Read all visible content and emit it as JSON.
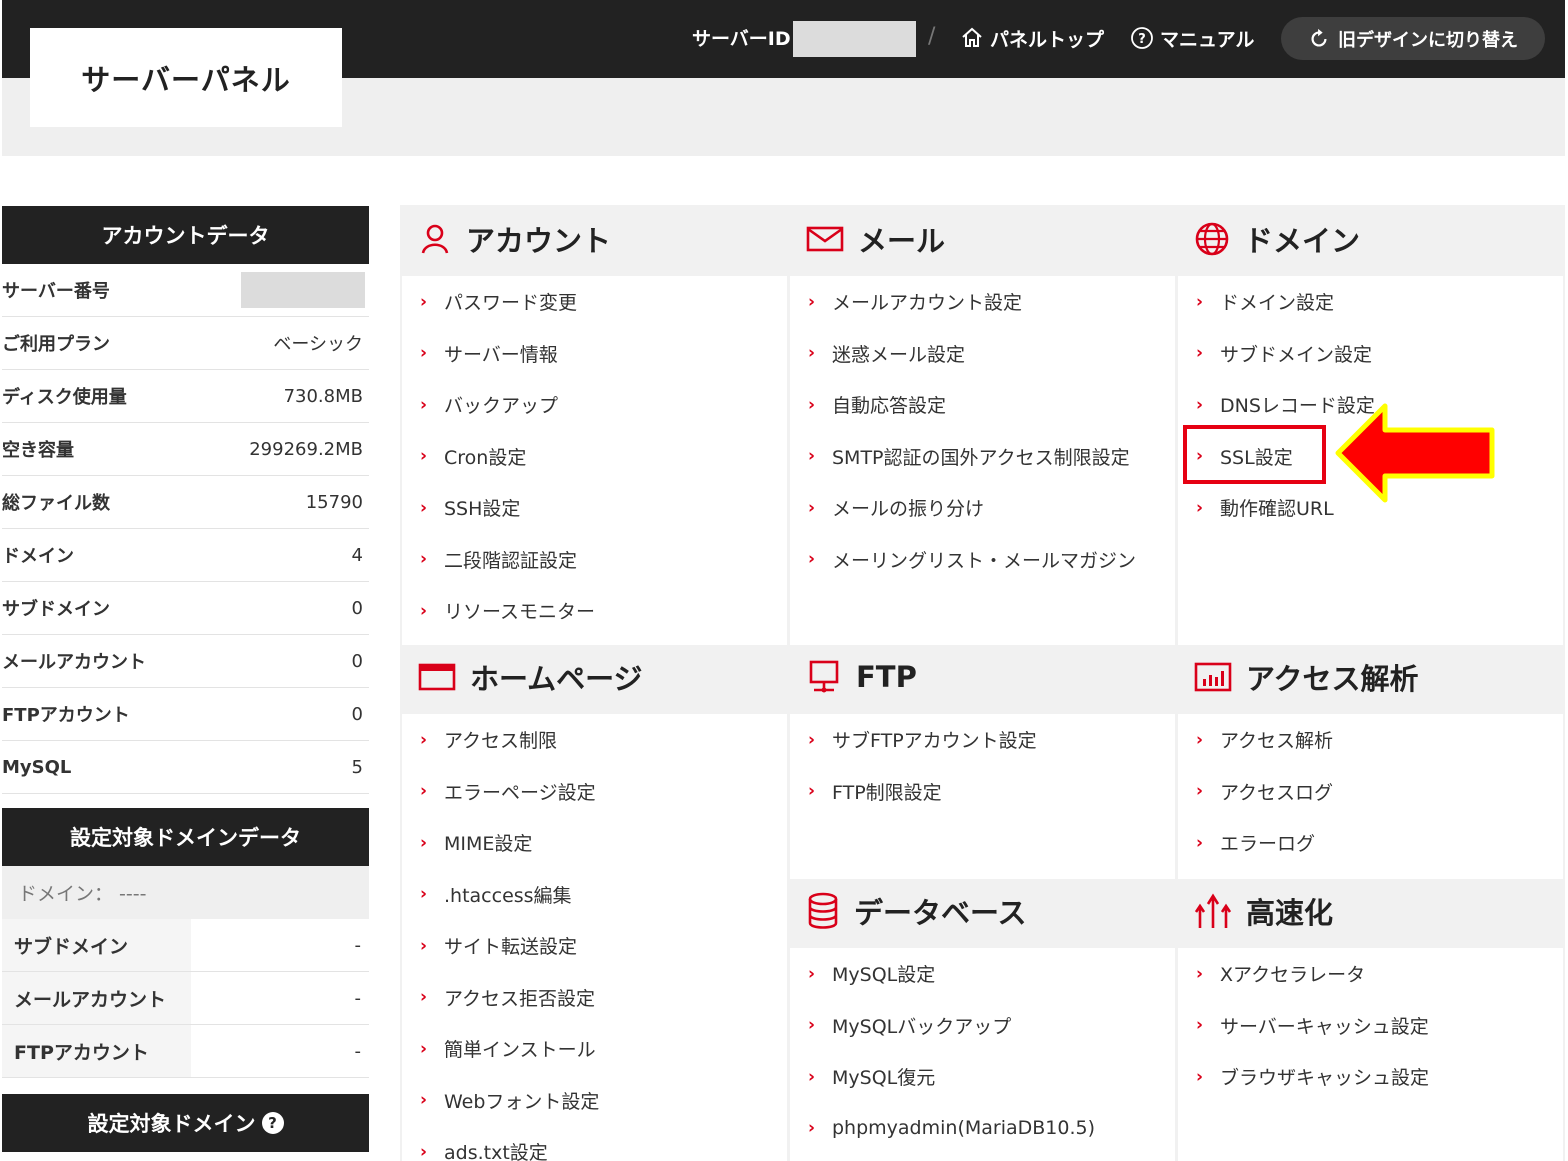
{
  "header": {
    "logo": "サーバーパネル",
    "server_id_label": "サーバーID",
    "separator": "/",
    "panel_top": "パネルトップ",
    "manual": "マニュアル",
    "switch_design": "旧デザインに切り替え"
  },
  "account_data": {
    "title": "アカウントデータ",
    "rows": [
      {
        "key": "サーバー番号",
        "value": ""
      },
      {
        "key": "ご利用プラン",
        "value": "ベーシック"
      },
      {
        "key": "ディスク使用量",
        "value": "730.8MB"
      },
      {
        "key": "空き容量",
        "value": "299269.2MB"
      },
      {
        "key": "総ファイル数",
        "value": "15790"
      },
      {
        "key": "ドメイン",
        "value": "4"
      },
      {
        "key": "サブドメイン",
        "value": "0"
      },
      {
        "key": "メールアカウント",
        "value": "0"
      },
      {
        "key": "FTPアカウント",
        "value": "0"
      },
      {
        "key": "MySQL",
        "value": "5"
      }
    ]
  },
  "target_domain_data": {
    "title": "設定対象ドメインデータ",
    "domain_line": "ドメイン： ----",
    "rows": [
      {
        "key": "サブドメイン",
        "value": "-"
      },
      {
        "key": "メールアカウント",
        "value": "-"
      },
      {
        "key": "FTPアカウント",
        "value": "-"
      }
    ]
  },
  "target_domain": {
    "title": "設定対象ドメイン",
    "help": "?"
  },
  "sections": {
    "account": {
      "title": "アカウント",
      "icon": "user-icon",
      "items": [
        "パスワード変更",
        "サーバー情報",
        "バックアップ",
        "Cron設定",
        "SSH設定",
        "二段階認証設定",
        "リソースモニター"
      ]
    },
    "mail": {
      "title": "メール",
      "icon": "mail-icon",
      "items": [
        "メールアカウント設定",
        "迷惑メール設定",
        "自動応答設定",
        "SMTP認証の国外アクセス制限設定",
        "メールの振り分け",
        "メーリングリスト・メールマガジン"
      ]
    },
    "domain": {
      "title": "ドメイン",
      "icon": "globe-icon",
      "items": [
        "ドメイン設定",
        "サブドメイン設定",
        "DNSレコード設定",
        "SSL設定",
        "動作確認URL"
      ]
    },
    "homepage": {
      "title": "ホームページ",
      "icon": "browser-window-icon",
      "items": [
        "アクセス制限",
        "エラーページ設定",
        "MIME設定",
        ".htaccess編集",
        "サイト転送設定",
        "アクセス拒否設定",
        "簡単インストール",
        "Webフォント設定",
        "ads.txt設定"
      ]
    },
    "ftp": {
      "title": "FTP",
      "icon": "monitor-icon",
      "items": [
        "サブFTPアカウント設定",
        "FTP制限設定"
      ]
    },
    "analytics": {
      "title": "アクセス解析",
      "icon": "bar-chart-icon",
      "items": [
        "アクセス解析",
        "アクセスログ",
        "エラーログ"
      ]
    },
    "database": {
      "title": "データベース",
      "icon": "database-icon",
      "items": [
        "MySQL設定",
        "MySQLバックアップ",
        "MySQL復元",
        "phpmyadmin(MariaDB10.5)"
      ]
    },
    "speed": {
      "title": "高速化",
      "icon": "speed-up-icon",
      "items": [
        "Xアクセラレータ",
        "サーバーキャッシュ設定",
        "ブラウザキャッシュ設定"
      ]
    }
  },
  "annotation": {
    "highlight_color": "#e60012",
    "arrow_color": "#ff0000",
    "arrow_outline": "#ffff00"
  },
  "colors": {
    "accent": "#d90019",
    "header_bg": "#222222"
  }
}
